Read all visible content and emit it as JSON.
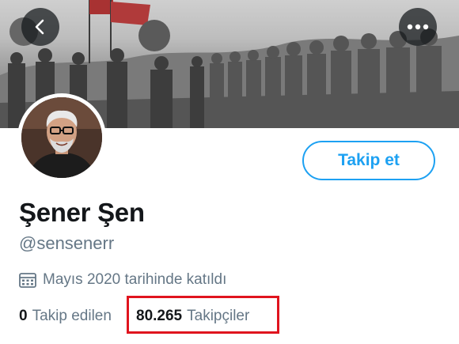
{
  "header": {
    "back_icon": "chevron-left-icon",
    "more_icon": "more-horizontal-icon"
  },
  "profile": {
    "display_name": "Şener Şen",
    "handle": "@sensenerr",
    "joined_icon": "calendar-icon",
    "joined_text": "Mayıs 2020 tarihinde katıldı",
    "follow_button_label": "Takip et"
  },
  "stats": {
    "following_count": "0",
    "following_label": "Takip edilen",
    "followers_count": "80.265",
    "followers_label": "Takipçiler"
  },
  "colors": {
    "accent": "#1da1f2",
    "highlight_box": "#e0141e",
    "secondary_text": "#657786"
  }
}
